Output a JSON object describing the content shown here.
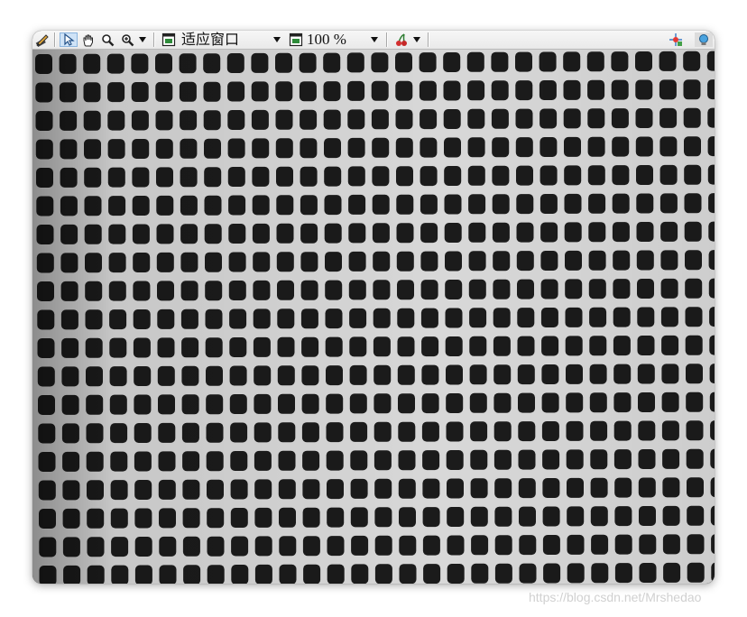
{
  "toolbar": {
    "zoom_fit_label": "适应窗口",
    "zoom_percent_label": "100 %",
    "tools": [
      {
        "name": "pencil-icon"
      },
      {
        "name": "pointer-icon"
      },
      {
        "name": "hand-pan-icon"
      },
      {
        "name": "zoom-icon"
      },
      {
        "name": "zoom-plus-icon"
      }
    ]
  },
  "image_view": {
    "subject": "fabric-mesh-grid",
    "colors": {
      "mesh": "#d8d8d8",
      "holes": "#1b1b1b"
    }
  },
  "watermark": "https://blog.csdn.net/Mrshedao"
}
